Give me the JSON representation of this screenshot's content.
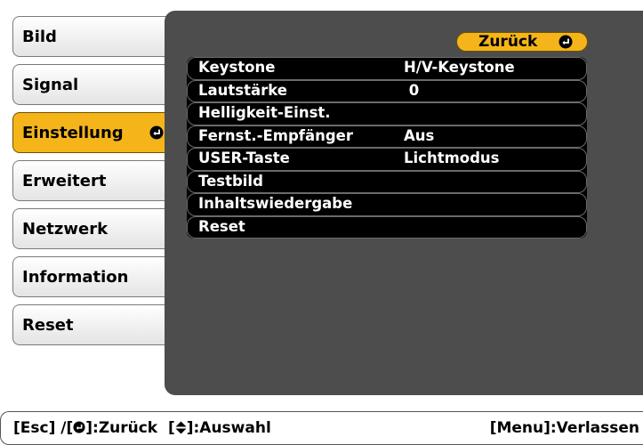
{
  "menu": {
    "items": [
      {
        "label": "Bild"
      },
      {
        "label": "Signal"
      },
      {
        "label": "Einstellung",
        "selected": true
      },
      {
        "label": "Erweitert"
      },
      {
        "label": "Netzwerk"
      },
      {
        "label": "Information"
      },
      {
        "label": "Reset"
      }
    ]
  },
  "panel": {
    "back_label": "Zurück",
    "rows": [
      {
        "label": "Keystone",
        "value": "H/V-Keystone"
      },
      {
        "label": "Lautstärke",
        "value": " 0"
      },
      {
        "label": "Helligkeit-Einst.",
        "value": ""
      },
      {
        "label": "Fernst.-Empfänger",
        "value": "Aus"
      },
      {
        "label": "USER-Taste",
        "value": "Lichtmodus"
      },
      {
        "label": "Testbild",
        "value": ""
      },
      {
        "label": "Inhaltswiedergabe",
        "value": ""
      },
      {
        "label": "Reset",
        "value": ""
      }
    ]
  },
  "status": {
    "left_prefix": "[Esc] /[",
    "left_mid": "]:Zurück  [",
    "left_suffix": "]:Auswahl",
    "right": "[Menu]:Verlassen"
  },
  "colors": {
    "accent": "#f5b51a",
    "panel_bg": "#4d4d4d",
    "row_bg": "#000000"
  },
  "icons": {
    "enter": "enter-icon",
    "updown": "up-down-arrow-icon"
  }
}
